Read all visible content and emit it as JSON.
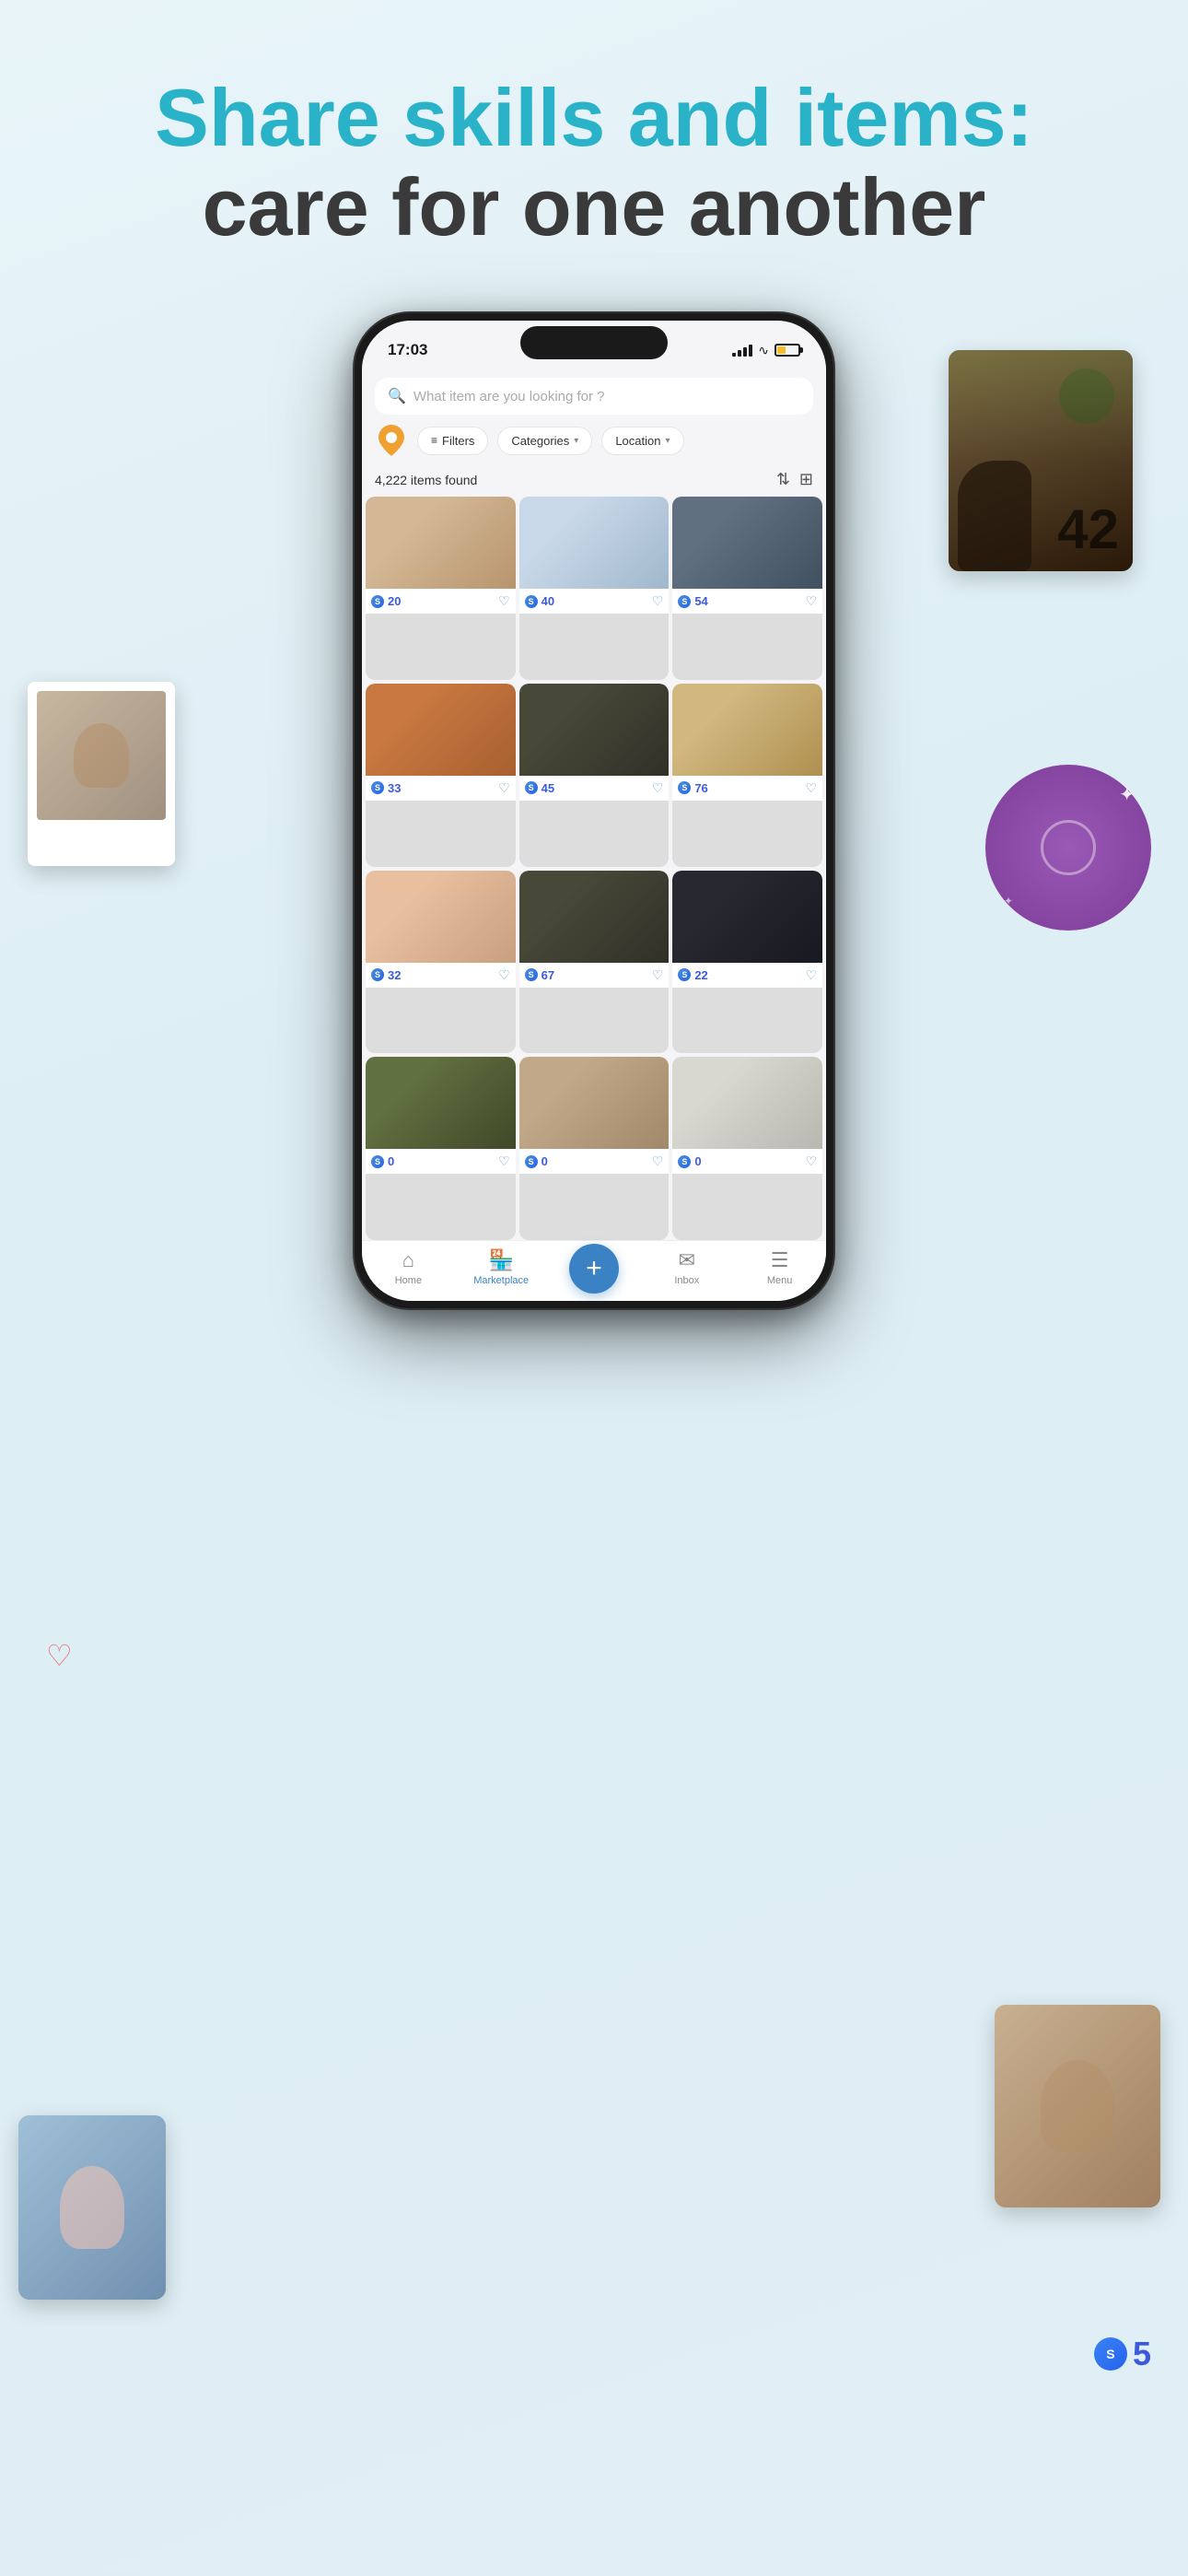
{
  "hero": {
    "line1": "Share skills and items:",
    "line2": "care for one another"
  },
  "status_bar": {
    "time": "17:03",
    "signal": "full",
    "battery_pct": 40
  },
  "search": {
    "placeholder": "What item are you looking for ?"
  },
  "filters": {
    "filters_label": "Filters",
    "categories_label": "Categories",
    "location_label": "Location"
  },
  "results": {
    "count_label": "4,222 items found"
  },
  "grid_items": [
    {
      "id": 1,
      "price": 20,
      "img_class": "img-yoga"
    },
    {
      "id": 2,
      "price": 40,
      "img_class": "img-ballet"
    },
    {
      "id": 3,
      "price": 54,
      "img_class": "img-photo"
    },
    {
      "id": 4,
      "price": 33,
      "img_class": "img-cooking"
    },
    {
      "id": 5,
      "price": 45,
      "img_class": "img-boxing"
    },
    {
      "id": 6,
      "price": 76,
      "img_class": "img-wellness"
    },
    {
      "id": 7,
      "price": 32,
      "img_class": "img-art"
    },
    {
      "id": 8,
      "price": 67,
      "img_class": "img-tutoring"
    },
    {
      "id": 9,
      "price": 22,
      "img_class": "img-fitness"
    },
    {
      "id": 10,
      "price": 0,
      "img_class": "img-gardening"
    },
    {
      "id": 11,
      "price": 0,
      "img_class": "img-fashion"
    },
    {
      "id": 12,
      "price": 0,
      "img_class": "img-dance"
    }
  ],
  "bottom_nav": {
    "items": [
      {
        "id": "home",
        "label": "Home",
        "active": false
      },
      {
        "id": "marketplace",
        "label": "Marketplace",
        "active": true
      },
      {
        "id": "add",
        "label": "+",
        "is_add": true
      },
      {
        "id": "inbox",
        "label": "Inbox",
        "active": false
      },
      {
        "id": "menu",
        "label": "Menu",
        "active": false
      }
    ]
  },
  "deco": {
    "number_overlay": "42",
    "token_number": "5"
  }
}
